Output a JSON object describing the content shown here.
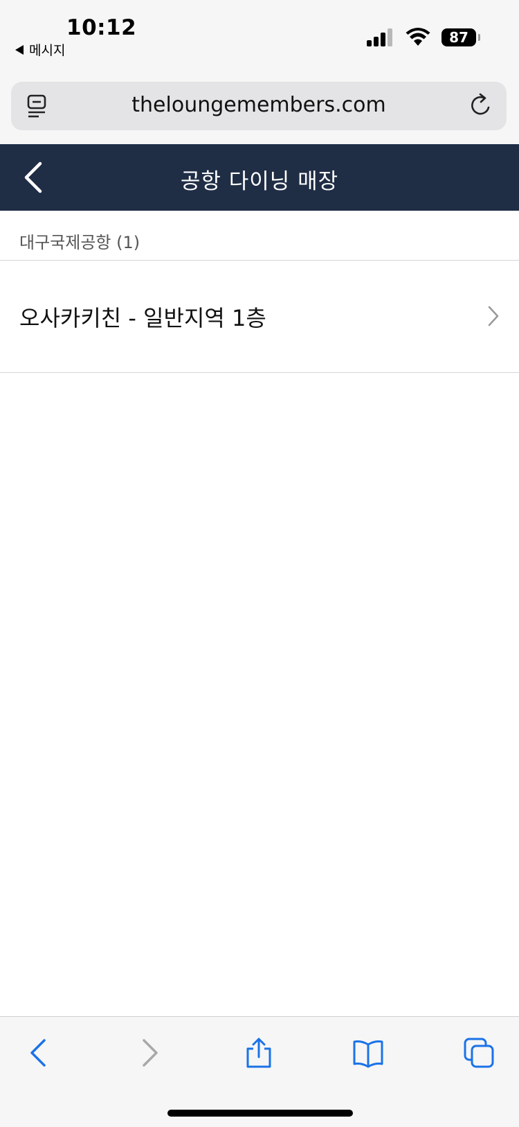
{
  "status_bar": {
    "time": "10:12",
    "back_app": "메시지",
    "battery": "87"
  },
  "browser": {
    "url": "theloungemembers.com",
    "icons": {
      "reader": "reader-icon",
      "reload": "reload-icon"
    }
  },
  "header": {
    "title": "공항 다이닝 매장",
    "back_icon": "chevron-left-icon"
  },
  "section": {
    "label": "대구국제공항 (1)"
  },
  "list": {
    "items": [
      {
        "name": "오사카키친 - 일반지역 1층"
      }
    ]
  },
  "toolbar": {
    "icons": [
      "back-icon",
      "forward-icon",
      "share-icon",
      "bookmarks-icon",
      "tabs-icon"
    ]
  },
  "colors": {
    "header_bg": "#1f2d45",
    "accent": "#1a73e8",
    "chrome_bg": "#f6f6f6"
  }
}
